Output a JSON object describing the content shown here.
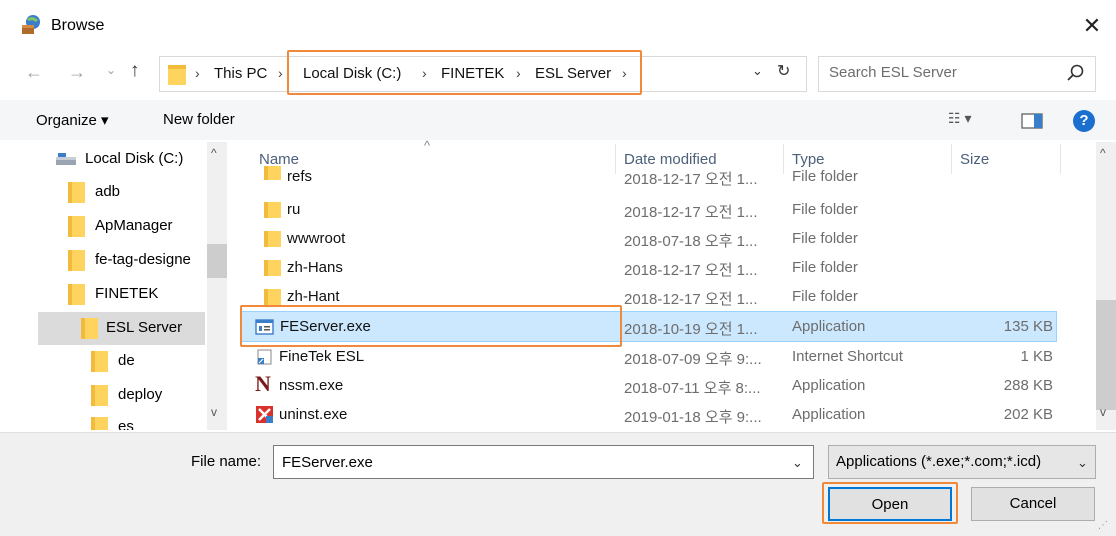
{
  "window": {
    "title": "Browse",
    "close_glyph": "✕"
  },
  "nav": {
    "back_glyph": "←",
    "forward_glyph": "→",
    "recent_glyph": "⌄",
    "up_glyph": "↑"
  },
  "address": {
    "crumbs": [
      "This PC",
      "Local Disk (C:)",
      "FINETEK",
      "ESL Server"
    ],
    "separator": "›",
    "dropdown_glyph": "⌄",
    "refresh_glyph": "↻"
  },
  "search": {
    "placeholder": "Search ESL Server"
  },
  "toolbar": {
    "organize_label": "Organize ▾",
    "new_folder_label": "New folder",
    "view_label": "☷ ▾",
    "help_label": "?"
  },
  "nav_pane": {
    "items": [
      {
        "label": "Local Disk (C:)",
        "icon": "drive-icon"
      },
      {
        "label": "adb",
        "icon": "folder-icon"
      },
      {
        "label": "ApManager",
        "icon": "folder-icon"
      },
      {
        "label": "fe-tag-designe",
        "icon": "folder-icon"
      },
      {
        "label": "FINETEK",
        "icon": "folder-icon"
      },
      {
        "label": "ESL Server",
        "icon": "folder-icon",
        "selected": true
      },
      {
        "label": "de",
        "icon": "folder-icon"
      },
      {
        "label": "deploy",
        "icon": "folder-icon"
      },
      {
        "label": "es",
        "icon": "folder-icon"
      }
    ]
  },
  "file_list": {
    "columns": [
      "Name",
      "Date modified",
      "Type",
      "Size"
    ],
    "rows": [
      {
        "name": "refs",
        "date": "2018-12-17 오전 1...",
        "type": "File folder",
        "size": "",
        "icon": "folder-icon"
      },
      {
        "name": "ru",
        "date": "2018-12-17 오전 1...",
        "type": "File folder",
        "size": "",
        "icon": "folder-icon"
      },
      {
        "name": "wwwroot",
        "date": "2018-07-18 오후 1...",
        "type": "File folder",
        "size": "",
        "icon": "folder-icon"
      },
      {
        "name": "zh-Hans",
        "date": "2018-12-17 오전 1...",
        "type": "File folder",
        "size": "",
        "icon": "folder-icon"
      },
      {
        "name": "zh-Hant",
        "date": "2018-12-17 오전 1...",
        "type": "File folder",
        "size": "",
        "icon": "folder-icon"
      },
      {
        "name": "FEServer.exe",
        "date": "2018-10-19 오전 1...",
        "type": "Application",
        "size": "135 KB",
        "icon": "application-icon",
        "selected": true
      },
      {
        "name": "FineTek ESL",
        "date": "2018-07-09 오후 9:...",
        "type": "Internet Shortcut",
        "size": "1 KB",
        "icon": "shortcut-icon"
      },
      {
        "name": "nssm.exe",
        "date": "2018-07-11 오후 8:...",
        "type": "Application",
        "size": "288 KB",
        "icon": "nssm-icon"
      },
      {
        "name": "uninst.exe",
        "date": "2019-01-18 오후 9:...",
        "type": "Application",
        "size": "202 KB",
        "icon": "uninstall-icon"
      }
    ]
  },
  "footer": {
    "file_name_label": "File name:",
    "file_name_value": "FEServer.exe",
    "file_type_label": "Applications (*.exe;*.com;*.icd)",
    "open_label": "Open",
    "cancel_label": "Cancel"
  },
  "colors": {
    "highlight": "#f08a3a",
    "selection": "#cce8ff",
    "accent": "#0078d7"
  }
}
